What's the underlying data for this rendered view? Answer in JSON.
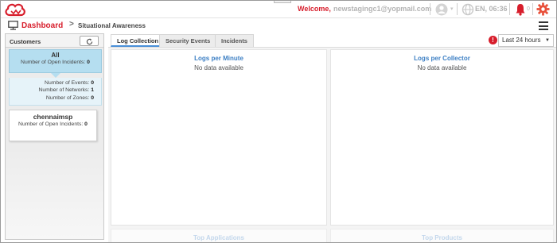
{
  "header": {
    "welcome_label": "Welcome,",
    "user_email": "newstagingc1@yopmail.com",
    "locale": "EN, 06:36",
    "notification_count": "0"
  },
  "breadcrumb": {
    "home": "Dashboard",
    "separator": ">",
    "current": "Situational Awareness"
  },
  "sidebar": {
    "title": "Customers",
    "customers": [
      {
        "name": "All",
        "open_incidents_label": "Number of Open Incidents:",
        "open_incidents": "0",
        "events_label": "Number of Events:",
        "events": "0",
        "networks_label": "Number of Networks:",
        "networks": "1",
        "zones_label": "Number of Zones:",
        "zones": "0"
      },
      {
        "name": "chennaimsp",
        "open_incidents_label": "Number of Open Incidents:",
        "open_incidents": "0"
      }
    ]
  },
  "main": {
    "tabs": [
      {
        "label": "Log Collection",
        "active": true
      },
      {
        "label": "Security Events",
        "active": false
      },
      {
        "label": "Incidents",
        "active": false
      }
    ],
    "time_range": "Last 24 hours",
    "panels": [
      {
        "title": "Logs per Minute",
        "empty_text": "No data available"
      },
      {
        "title": "Logs per Collector",
        "empty_text": "No data available"
      }
    ],
    "lower_panels": [
      {
        "title": "Top Applications"
      },
      {
        "title": "Top Products"
      }
    ]
  },
  "colors": {
    "brand_red": "#d71d2b",
    "link_blue": "#3c7fc4",
    "selected_customer_bg": "#b5def0"
  },
  "icons": [
    "cloud-logo-icon",
    "user-icon",
    "globe-icon",
    "bell-icon",
    "gear-icon",
    "monitor-icon",
    "refresh-icon",
    "hamburger-menu-icon",
    "alert-icon"
  ]
}
